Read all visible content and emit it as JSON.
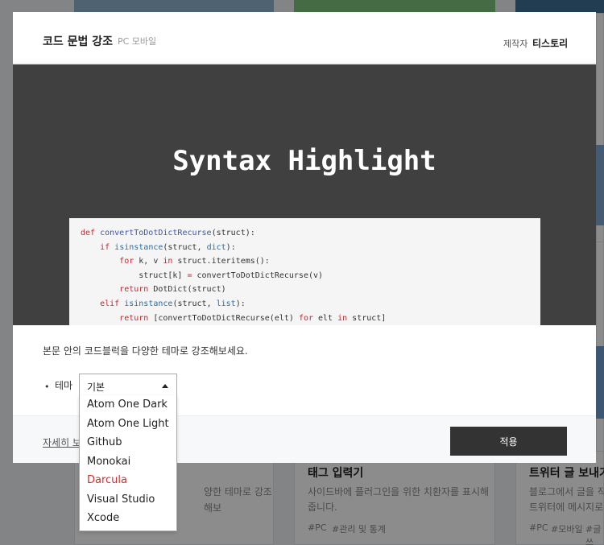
{
  "background": {
    "cards": [
      {
        "title": "태그 입력기",
        "desc_lines": [
          "사이드바에 플러그인을 위한 치환자를 표시해",
          "줍니다."
        ],
        "tags": [
          "#PC",
          "#관리 및 통계"
        ]
      },
      {
        "title": "트위터 글 보내기",
        "desc_lines": [
          "블로그에서 글을 작성",
          "트위터에 메시지로 보"
        ],
        "tags": [
          "#PC",
          "#모바일",
          "#글쓰"
        ]
      },
      {
        "title": "",
        "desc_lines": [
          "양한 테마로 강조해보"
        ],
        "tags": []
      }
    ]
  },
  "modal": {
    "title": "코드 문법 강조",
    "subtitle": "PC 모바일",
    "maker_label": "제작자",
    "maker_name": "티스토리",
    "hero_title": "Syntax Highlight",
    "code_lines": [
      "def convertToDotDictRecurse(struct):",
      "    if isinstance(struct, dict):",
      "        for k, v in struct.iteritems():",
      "            struct[k] = convertToDotDictRecurse(v)",
      "        return DotDict(struct)",
      "    elif isinstance(struct, list):",
      "        return [convertToDotDictRecurse(elt) for elt in struct]"
    ],
    "description": "본문 안의 코드블럭을 다양한 테마로 강조해보세요.",
    "option_bullet": "•",
    "option_label": "테마",
    "detail_link": "자세히 보기",
    "apply_label": "적용"
  },
  "theme_select": {
    "selected": "기본",
    "options": [
      "Atom One Dark",
      "Atom One Light",
      "Github",
      "Monokai",
      "Darcula",
      "Visual Studio",
      "Xcode"
    ],
    "highlighted": "Darcula",
    "highlight_color": "#d0302f"
  }
}
